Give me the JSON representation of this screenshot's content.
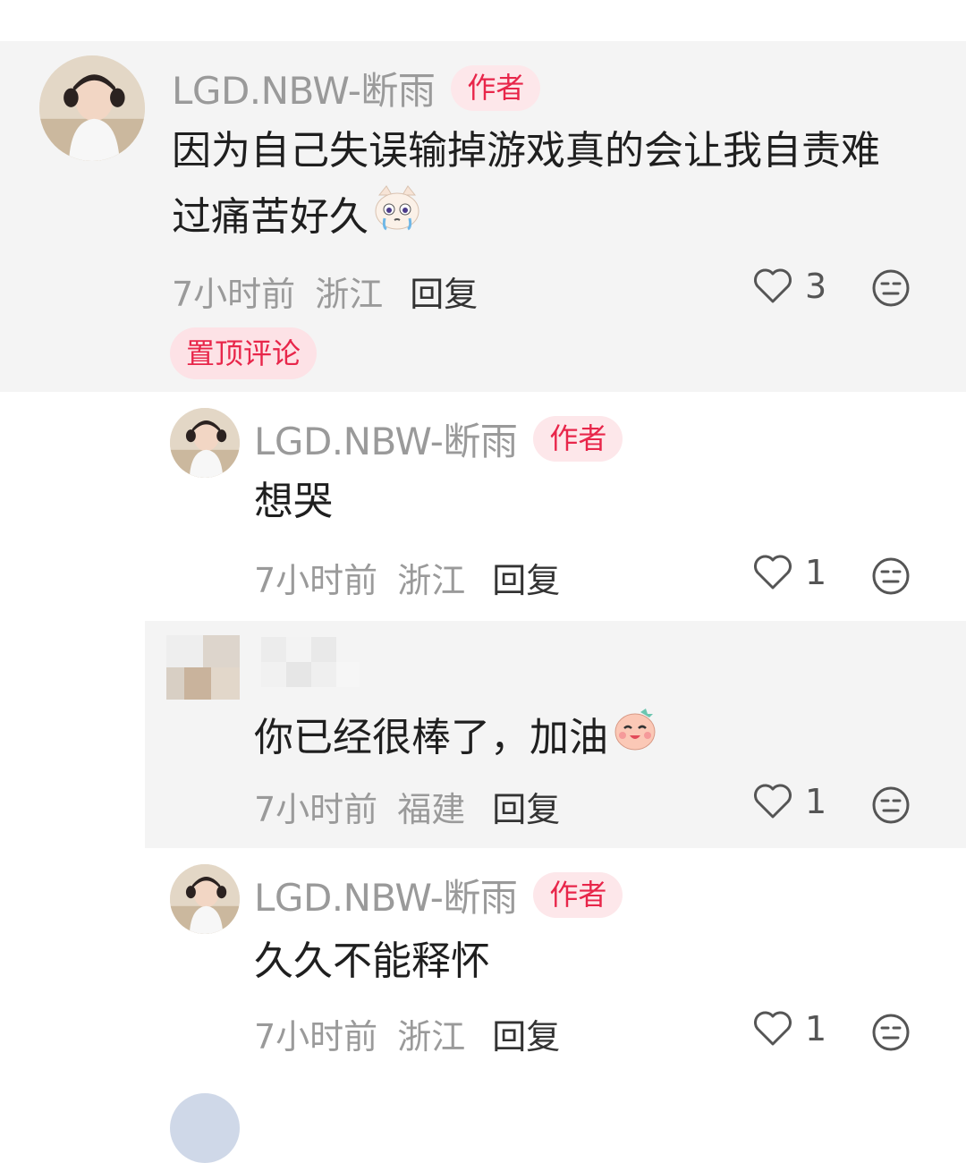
{
  "pinned_comment": {
    "author": "LGD.NBW-断雨",
    "badge": "作者",
    "text_line1": "因为自己失误输掉游戏真的会让我自责难",
    "text_line2": "过痛苦好久",
    "emoji": "crying-cat",
    "time": "7小时前",
    "region": "浙江",
    "reply_label": "回复",
    "likes": "3",
    "pin_label": "置顶评论"
  },
  "replies": [
    {
      "author": "LGD.NBW-断雨",
      "badge": "作者",
      "text": "想哭",
      "time": "7小时前",
      "region": "浙江",
      "reply_label": "回复",
      "likes": "1"
    },
    {
      "author": "",
      "text": "你已经很棒了，加油",
      "emoji": "cheer-face",
      "time": "7小时前",
      "region": "福建",
      "reply_label": "回复",
      "likes": "1"
    },
    {
      "author": "LGD.NBW-断雨",
      "badge": "作者",
      "text": "久久不能释怀",
      "time": "7小时前",
      "region": "浙江",
      "reply_label": "回复",
      "likes": "1"
    }
  ],
  "colors": {
    "accent": "#e8264a",
    "badge_bg": "#fde7ea",
    "shade_bg": "#f4f4f4"
  },
  "icons": [
    "heart-outline-icon",
    "dislike-face-icon"
  ]
}
